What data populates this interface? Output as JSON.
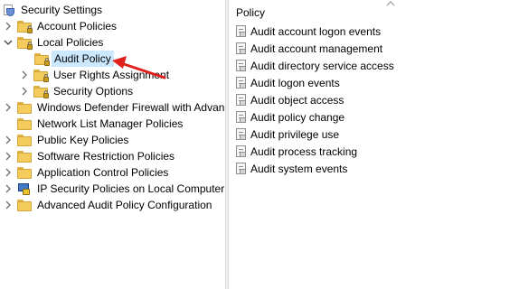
{
  "tree": {
    "root": {
      "label": "Security Settings",
      "icon": "security-settings-icon"
    },
    "items": [
      {
        "label": "Account Policies",
        "icon": "folder-lock-icon"
      },
      {
        "label": "Local Policies",
        "icon": "folder-lock-icon"
      },
      {
        "label": "Audit Policy",
        "icon": "folder-lock-icon"
      },
      {
        "label": "User Rights Assignment",
        "icon": "folder-lock-icon"
      },
      {
        "label": "Security Options",
        "icon": "folder-lock-icon"
      },
      {
        "label": "Windows Defender Firewall with Advanc",
        "icon": "folder-icon"
      },
      {
        "label": "Network List Manager Policies",
        "icon": "folder-icon"
      },
      {
        "label": "Public Key Policies",
        "icon": "folder-icon"
      },
      {
        "label": "Software Restriction Policies",
        "icon": "folder-icon"
      },
      {
        "label": "Application Control Policies",
        "icon": "folder-icon"
      },
      {
        "label": "IP Security Policies on Local Computer",
        "icon": "ipsec-icon"
      },
      {
        "label": "Advanced Audit Policy Configuration",
        "icon": "folder-icon"
      }
    ],
    "selected": "Audit Policy"
  },
  "list": {
    "column_header": "Policy",
    "items": [
      "Audit account logon events",
      "Audit account management",
      "Audit directory service access",
      "Audit logon events",
      "Audit object access",
      "Audit policy change",
      "Audit privilege use",
      "Audit process tracking",
      "Audit system events"
    ]
  },
  "colors": {
    "selection": "#cce8ff",
    "annotation_arrow": "#e0201b",
    "folder": "#f3cc5b"
  }
}
